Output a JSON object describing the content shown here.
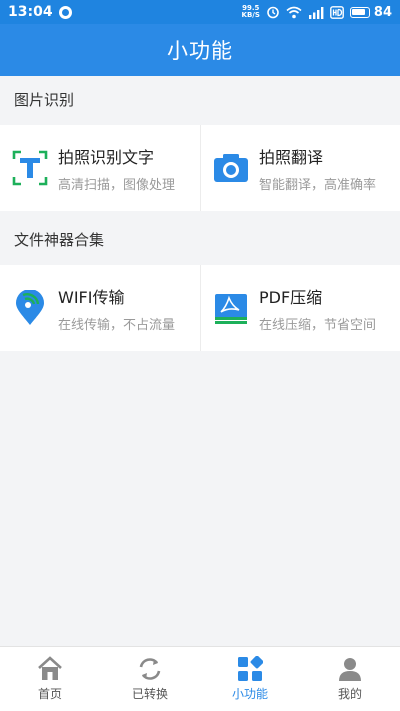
{
  "status_bar": {
    "time": "13:04",
    "net_speed_value": "99.5",
    "net_speed_unit": "KB/S",
    "battery_percent": "84",
    "battery_level": 0.84,
    "icons": [
      "notification-icon",
      "alarm-icon",
      "wifi-icon",
      "signal-icon",
      "hd-icon",
      "battery-icon"
    ]
  },
  "header": {
    "title": "小功能"
  },
  "sections": [
    {
      "title": "图片识别",
      "items": [
        {
          "title": "拍照识别文字",
          "subtitle": "高清扫描，图像处理",
          "icon": "text-recognition-icon"
        },
        {
          "title": "拍照翻译",
          "subtitle": "智能翻译，高准确率",
          "icon": "camera-icon"
        }
      ]
    },
    {
      "title": "文件神器合集",
      "items": [
        {
          "title": "WIFI传输",
          "subtitle": "在线传输，不占流量",
          "icon": "wifi-location-icon"
        },
        {
          "title": "PDF压缩",
          "subtitle": "在线压缩，节省空间",
          "icon": "pdf-compress-icon"
        }
      ]
    }
  ],
  "bottom_nav": [
    {
      "label": "首页",
      "icon": "home-icon",
      "active": false
    },
    {
      "label": "已转换",
      "icon": "refresh-icon",
      "active": false
    },
    {
      "label": "小功能",
      "icon": "grid-icon",
      "active": true
    },
    {
      "label": "我的",
      "icon": "user-icon",
      "active": false
    }
  ],
  "colors": {
    "primary": "#2b8ae6",
    "status_bar": "#1f84e0",
    "text_icon_green": "#1db05a",
    "text_icon_blue": "#2b8ae6",
    "nav_inactive": "#8a8a8a"
  }
}
